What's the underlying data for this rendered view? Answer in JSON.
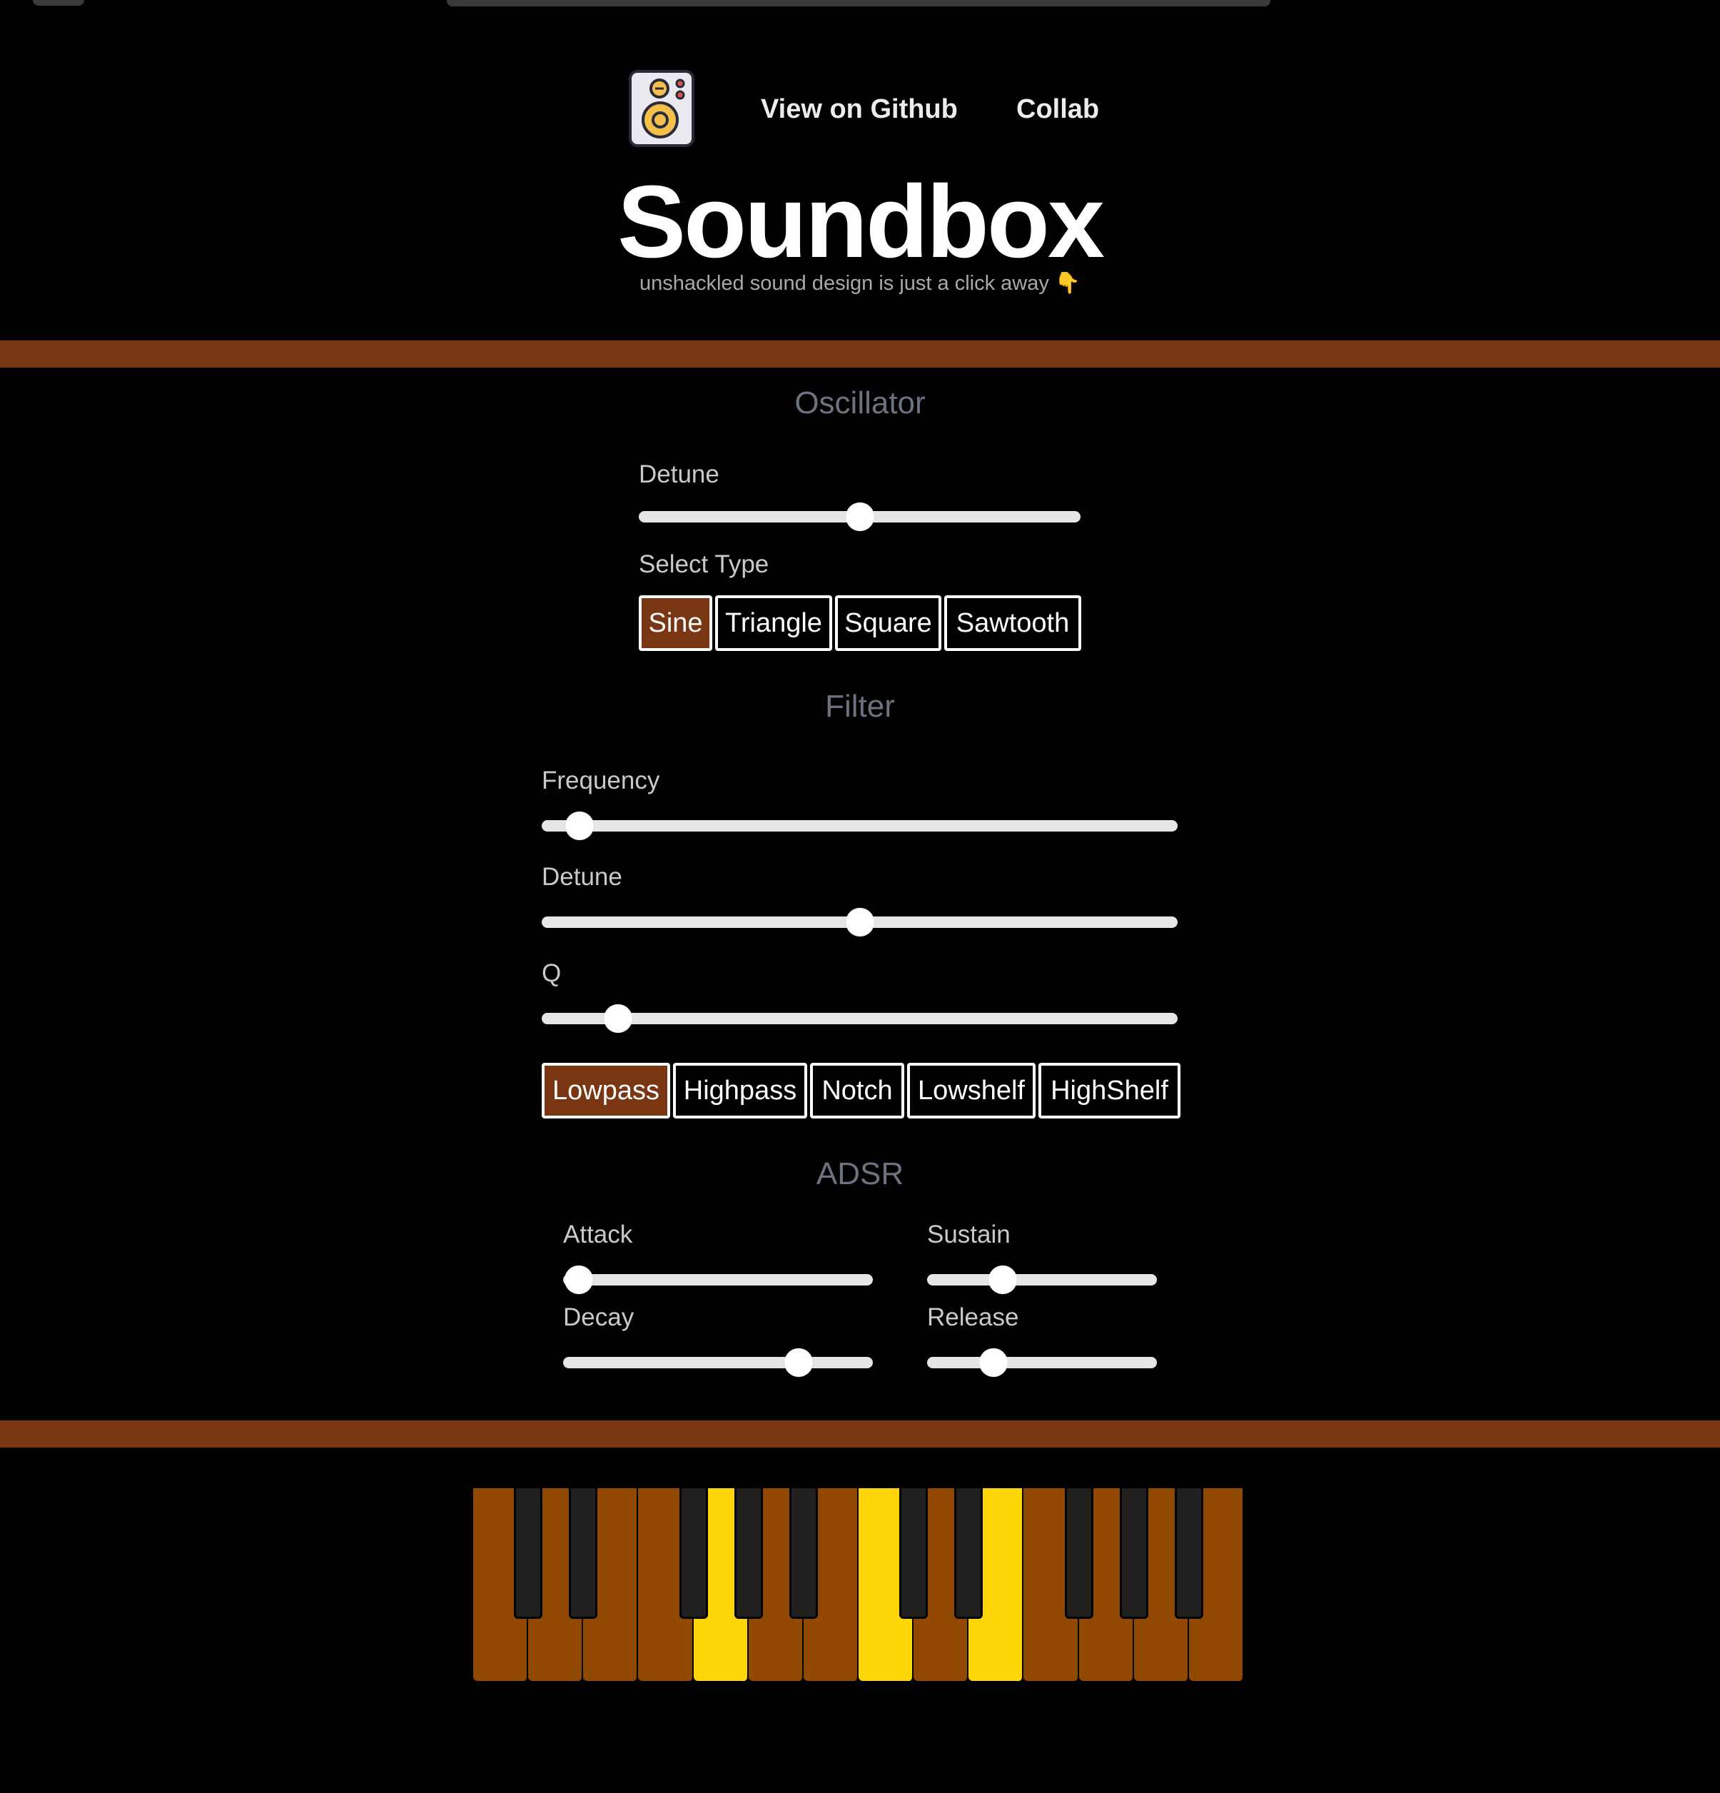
{
  "header": {
    "nav": {
      "github_label": "View on Github",
      "collab_label": "Collab"
    },
    "title": "Soundbox",
    "subtitle": "unshackled sound design is just a click away 👇"
  },
  "oscillator": {
    "title": "Oscillator",
    "detune_label": "Detune",
    "detune_value": 0.5,
    "select_type_label": "Select Type",
    "types": [
      "Sine",
      "Triangle",
      "Square",
      "Sawtooth"
    ],
    "active_type": "Sine"
  },
  "filter": {
    "title": "Filter",
    "frequency_label": "Frequency",
    "frequency_value": 0.06,
    "detune_label": "Detune",
    "detune_value": 0.5,
    "q_label": "Q",
    "q_value": 0.12,
    "types": [
      "Lowpass",
      "Highpass",
      "Notch",
      "Lowshelf",
      "HighShelf"
    ],
    "active_type": "Lowpass"
  },
  "adsr": {
    "title": "ADSR",
    "attack_label": "Attack",
    "attack_value": 0.05,
    "decay_label": "Decay",
    "decay_value": 0.76,
    "sustain_label": "Sustain",
    "sustain_value": 0.33,
    "release_label": "Release",
    "release_value": 0.29
  },
  "keyboard": {
    "white_keys": 14,
    "highlighted_white_keys": [
      4,
      7,
      9
    ],
    "black_key_after_white": [
      0,
      1,
      3,
      4,
      5,
      7,
      8,
      10,
      11,
      12
    ]
  },
  "colors": {
    "accent": "#7a3512",
    "key_white": "#914902",
    "key_lit": "#fed607",
    "key_black": "#221f1f"
  }
}
